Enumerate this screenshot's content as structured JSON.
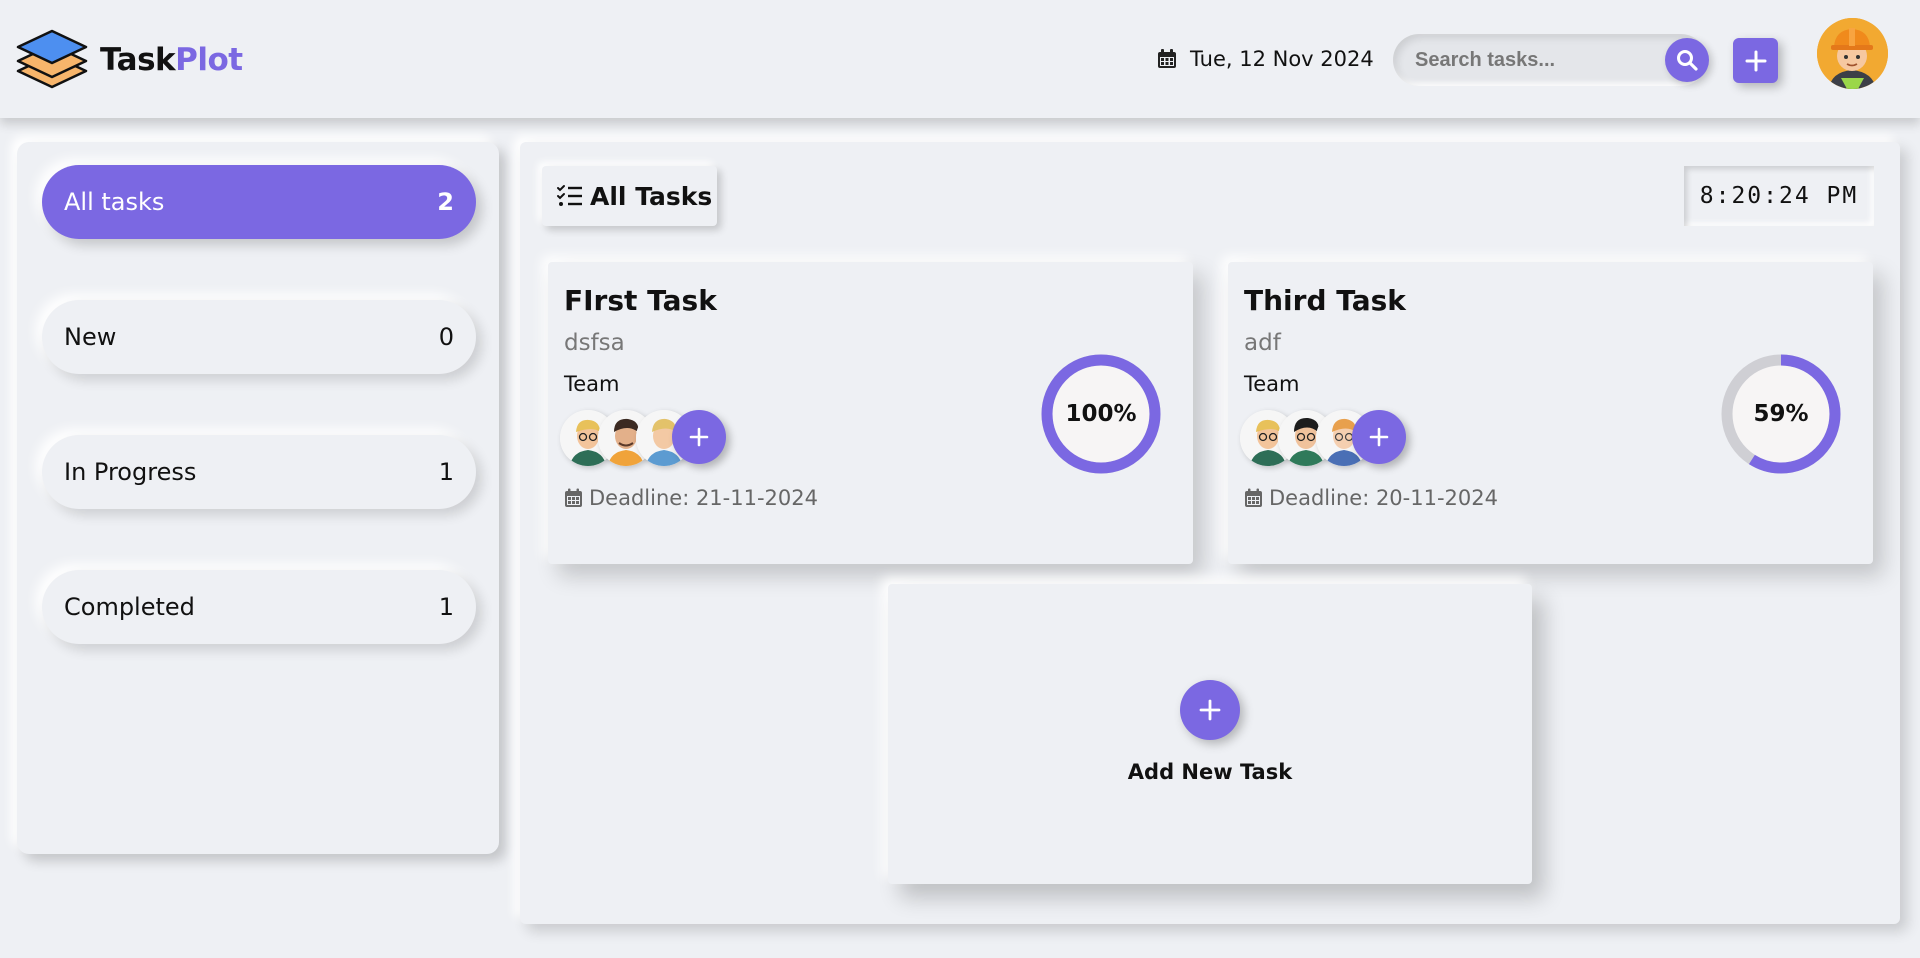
{
  "header": {
    "brand_part1": "Task",
    "brand_part2": "Plot",
    "date": "Tue, 12 Nov 2024",
    "search_placeholder": "Search tasks..."
  },
  "sidebar": {
    "items": [
      {
        "label": "All tasks",
        "count": "2",
        "active": true
      },
      {
        "label": "New",
        "count": "0",
        "active": false
      },
      {
        "label": "In Progress",
        "count": "1",
        "active": false
      },
      {
        "label": "Completed",
        "count": "1",
        "active": false
      }
    ]
  },
  "main": {
    "title": "All Tasks",
    "clock": "8:20:24 PM",
    "tasks": [
      {
        "title": "FIrst Task",
        "description": "dsfsa",
        "team_label": "Team",
        "deadline": "Deadline: 21-11-2024",
        "progress_label": "100%",
        "progress": 1.0
      },
      {
        "title": "Third Task",
        "description": "adf",
        "team_label": "Team",
        "deadline": "Deadline: 20-11-2024",
        "progress_label": "59%",
        "progress": 0.59
      }
    ],
    "add_task_label": "Add New Task"
  },
  "colors": {
    "accent": "#7b68e2",
    "background": "#eef0f4",
    "progress_track": "#cfcfd4"
  },
  "icons": [
    "layers-logo-icon",
    "calendar-icon",
    "search-icon",
    "plus-icon",
    "user-avatar",
    "task-list-icon"
  ]
}
